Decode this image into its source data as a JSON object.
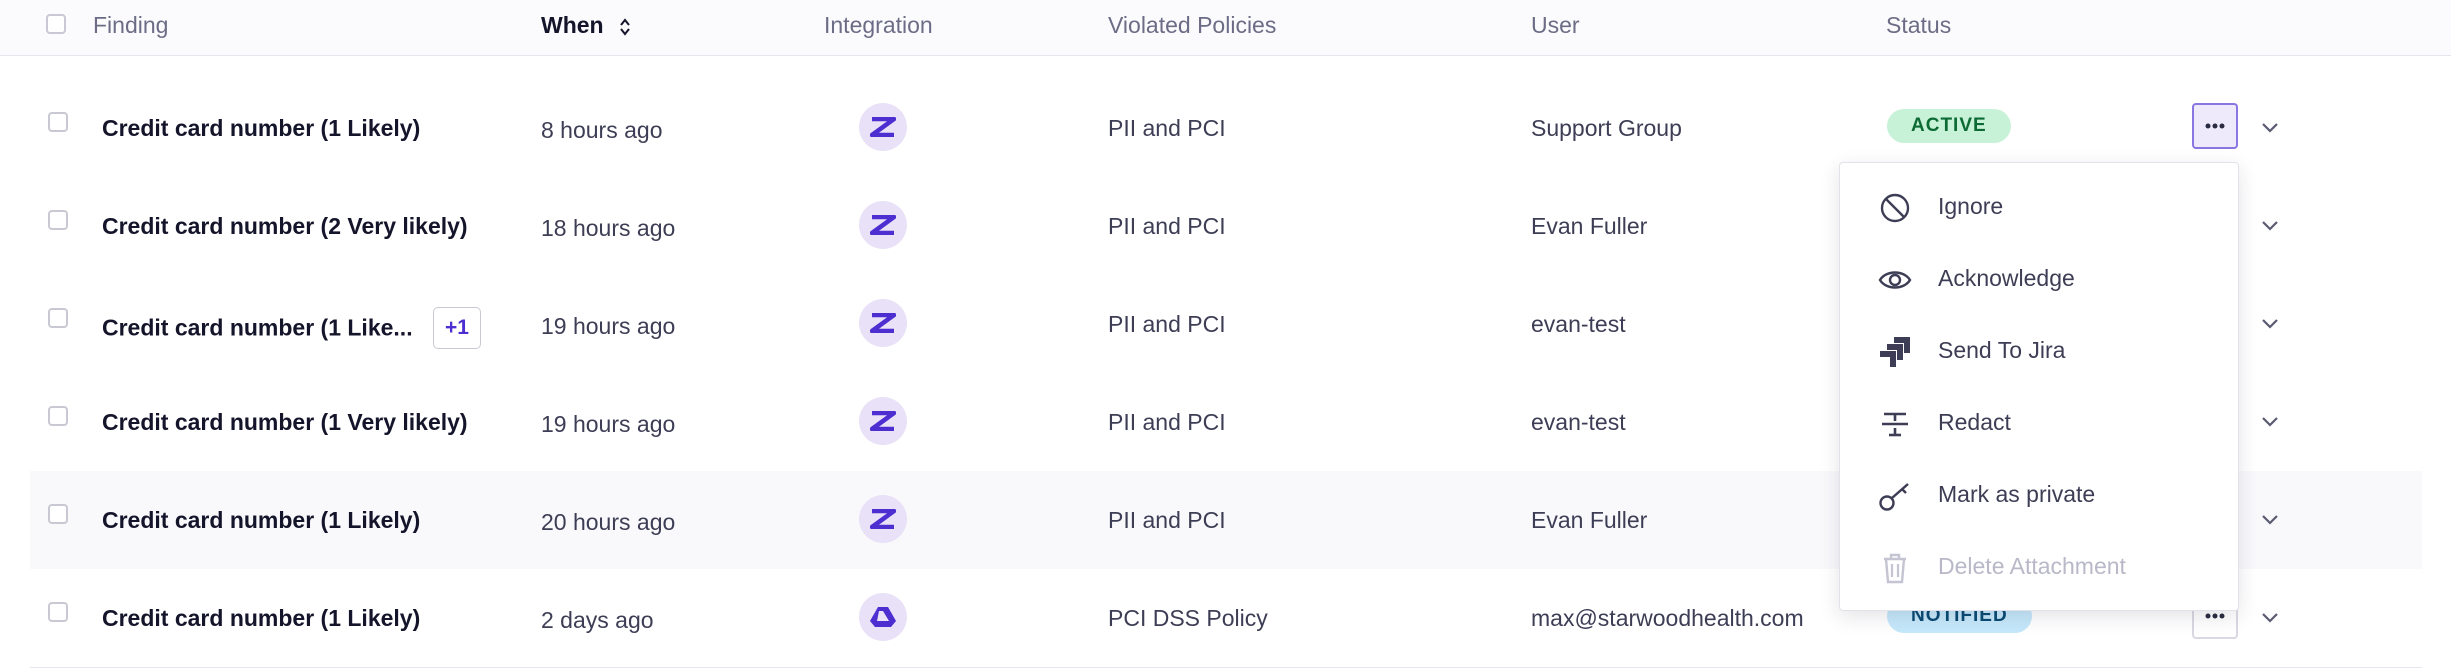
{
  "header": {
    "finding": "Finding",
    "when": "When",
    "integration": "Integration",
    "violated_policies": "Violated Policies",
    "user": "User",
    "status": "Status"
  },
  "rows": [
    {
      "finding": "Credit card number (1 Likely)",
      "when": "8 hours ago",
      "integration": "zendesk-icon",
      "policy": "PII and PCI",
      "user": "Support Group",
      "status": "ACTIVE"
    },
    {
      "finding": "Credit card number (2 Very likely)",
      "when": "18 hours ago",
      "integration": "zendesk-icon",
      "policy": "PII and PCI",
      "user": "Evan Fuller"
    },
    {
      "finding": "Credit card number (1 Like...",
      "extra": "+1",
      "when": "19 hours ago",
      "integration": "zendesk-icon",
      "policy": "PII and PCI",
      "user": "evan-test"
    },
    {
      "finding": "Credit card number (1 Very likely)",
      "when": "19 hours ago",
      "integration": "zendesk-icon",
      "policy": "PII and PCI",
      "user": "evan-test"
    },
    {
      "finding": "Credit card number (1 Likely)",
      "when": "20 hours ago",
      "integration": "zendesk-icon",
      "policy": "PII and PCI",
      "user": "Evan Fuller"
    },
    {
      "finding": "Credit card number (1 Likely)",
      "when": "2 days ago",
      "integration": "google-drive-icon",
      "policy": "PCI DSS Policy",
      "user": "max@starwoodhealth.com",
      "status": "NOTIFIED"
    }
  ],
  "menu": {
    "items": [
      {
        "label": "Ignore",
        "icon": "ignore-icon",
        "enabled": true
      },
      {
        "label": "Acknowledge",
        "icon": "eye-icon",
        "enabled": true
      },
      {
        "label": "Send To Jira",
        "icon": "jira-icon",
        "enabled": true
      },
      {
        "label": "Redact",
        "icon": "redact-icon",
        "enabled": true
      },
      {
        "label": "Mark as private",
        "icon": "key-icon",
        "enabled": true
      },
      {
        "label": "Delete Attachment",
        "icon": "trash-icon",
        "enabled": false
      }
    ]
  },
  "colors": {
    "accent": "#4d2ed1",
    "active_bg": "#c8f2d7",
    "notified_bg": "#c6e8fb",
    "icon_bg": "#e8e1f7"
  }
}
